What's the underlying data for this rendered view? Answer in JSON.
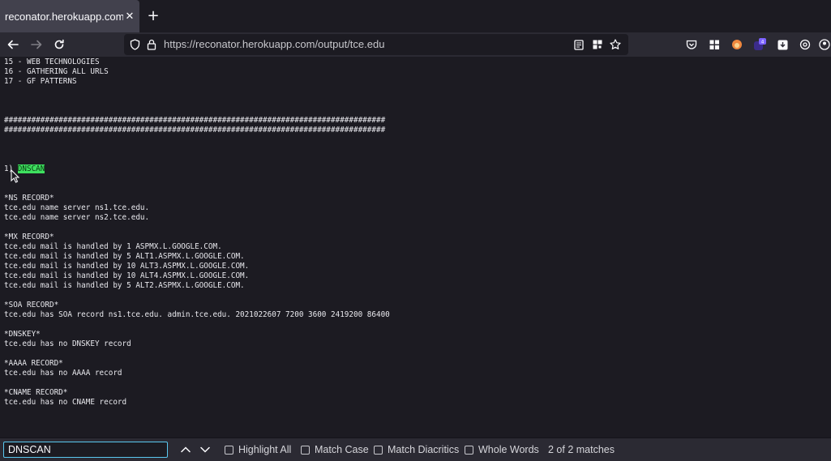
{
  "tab": {
    "title": "reconator.herokuapp.com/ou",
    "close": "✕",
    "new_tab": "+"
  },
  "url": "https://reconator.herokuapp.com/output/tce.edu",
  "output_lines": [
    "15 - WEB TECHNOLOGIES",
    "16 - GATHERING ALL URLS",
    "17 - GF PATTERNS",
    "",
    "",
    "",
    "####################################################################################",
    "####################################################################################",
    "",
    "",
    "",
    "__HL__",
    "",
    "",
    "*NS RECORD*",
    "tce.edu name server ns1.tce.edu.",
    "tce.edu name server ns2.tce.edu.",
    "",
    "*MX RECORD*",
    "tce.edu mail is handled by 1 ASPMX.L.GOOGLE.COM.",
    "tce.edu mail is handled by 5 ALT1.ASPMX.L.GOOGLE.COM.",
    "tce.edu mail is handled by 10 ALT3.ASPMX.L.GOOGLE.COM.",
    "tce.edu mail is handled by 10 ALT4.ASPMX.L.GOOGLE.COM.",
    "tce.edu mail is handled by 5 ALT2.ASPMX.L.GOOGLE.COM.",
    "",
    "*SOA RECORD*",
    "tce.edu has SOA record ns1.tce.edu. admin.tce.edu. 2021022607 7200 3600 2419200 86400",
    "",
    "*DNSKEY*",
    "tce.edu has no DNSKEY record",
    "",
    "*AAAA RECORD*",
    "tce.edu has no AAAA record",
    "",
    "*CNAME RECORD*",
    "tce.edu has no CNAME record",
    "",
    "",
    "",
    "",
    "####################################################################################"
  ],
  "highlight_line": {
    "prefix": "1) ",
    "match": "DNSCAN"
  },
  "find": {
    "value": "DNSCAN",
    "options": [
      "Highlight All",
      "Match Case",
      "Match Diacritics",
      "Whole Words"
    ],
    "matches": "2 of 2 matches"
  },
  "colors": {
    "highlight": "#3ee05f",
    "find_focus": "#5ac8f0",
    "extension_badge": "4"
  }
}
